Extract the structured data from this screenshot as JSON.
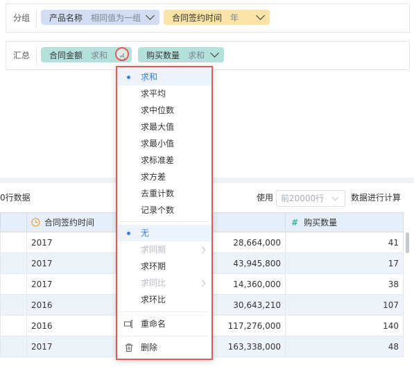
{
  "groupBar": {
    "label": "分组",
    "chips": [
      {
        "name": "产品名称",
        "agg": "相同值为一组"
      },
      {
        "name": "合同签约时间",
        "agg": "年"
      }
    ]
  },
  "summaryBar": {
    "label": "汇总",
    "chips": [
      {
        "name": "合同金额",
        "agg": "求和"
      },
      {
        "name": "购买数量",
        "agg": "求和"
      }
    ]
  },
  "info": {
    "left_text": "0行数据",
    "use_label": "使用",
    "rows_select": "前20000行",
    "compute_label": "数据进行计算"
  },
  "table": {
    "headers": [
      "合同签约时间",
      "",
      "购买数量"
    ],
    "rows": [
      {
        "year": "2017",
        "amount": "28,664,000",
        "qty": "41"
      },
      {
        "year": "2017",
        "amount": "43,945,800",
        "qty": "17"
      },
      {
        "year": "2017",
        "amount": "14,360,000",
        "qty": "38"
      },
      {
        "year": "2016",
        "amount": "30,643,210",
        "qty": "107"
      },
      {
        "year": "2016",
        "amount": "117,276,000",
        "qty": "140"
      },
      {
        "year": "2017",
        "amount": "163,338,000",
        "qty": "48"
      }
    ]
  },
  "menu": {
    "aggregations": [
      "求和",
      "求平均",
      "求中位数",
      "求最大值",
      "求最小值",
      "求标准差",
      "求方差",
      "去重计数",
      "记录个数"
    ],
    "selected_aggregation": "求和",
    "comparisons": [
      {
        "label": "无",
        "selected": true,
        "disabled": false
      },
      {
        "label": "求同期",
        "disabled": true,
        "submenu": true
      },
      {
        "label": "求环期",
        "disabled": false
      },
      {
        "label": "求同比",
        "disabled": true,
        "submenu": true
      },
      {
        "label": "求环比",
        "disabled": false
      }
    ],
    "rename": "重命名",
    "delete": "删除"
  },
  "colors": {
    "accent": "#3d7be0",
    "highlight_red": "#e25a53",
    "chip_blue": "#d2dcf2",
    "chip_yellow": "#fae3a6",
    "chip_teal": "#b4e2da"
  }
}
